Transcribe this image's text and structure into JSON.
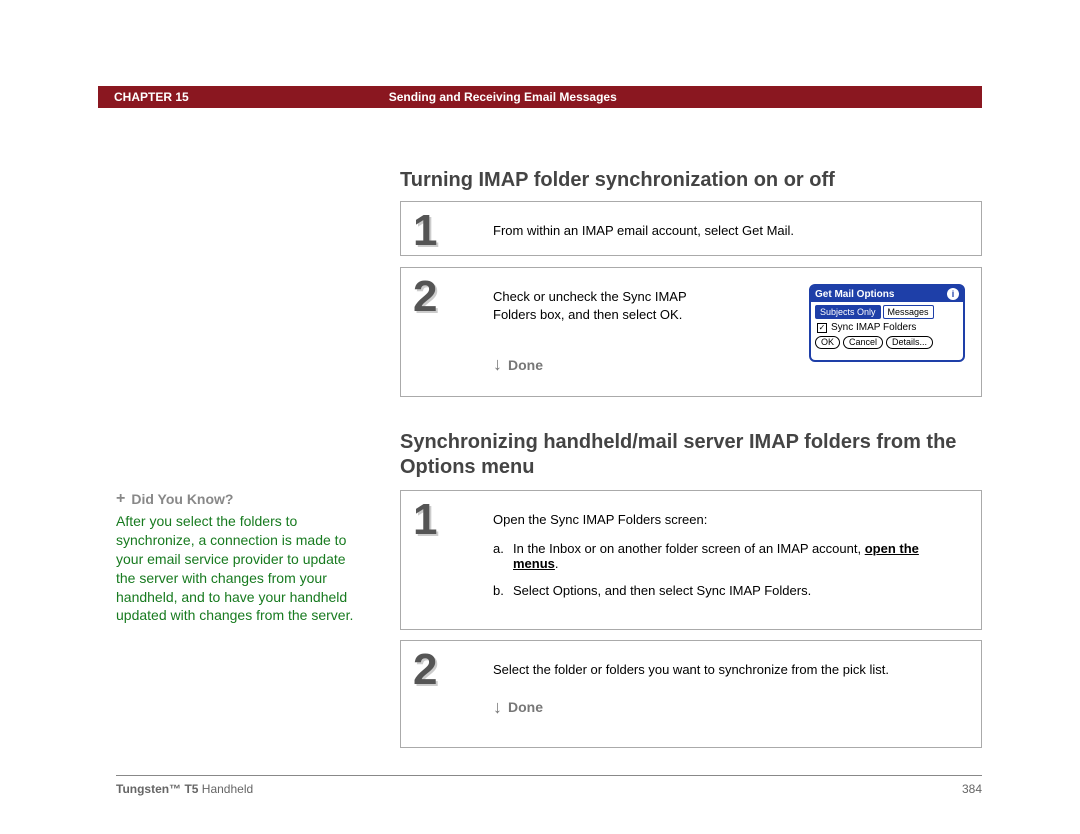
{
  "header": {
    "chapter": "CHAPTER 15",
    "title": "Sending and Receiving Email Messages"
  },
  "section1": {
    "title": "Turning IMAP folder synchronization on or off",
    "step1": {
      "num": "1",
      "text": "From within an IMAP email account, select Get Mail."
    },
    "step2": {
      "num": "2",
      "text": "Check or uncheck the Sync IMAP Folders box, and then select OK.",
      "done": "Done"
    }
  },
  "dialog": {
    "title": "Get Mail Options",
    "tab1": "Subjects Only",
    "tab2": "Messages",
    "check": "Sync IMAP Folders",
    "btn_ok": "OK",
    "btn_cancel": "Cancel",
    "btn_details": "Details..."
  },
  "section2": {
    "title": "Synchronizing handheld/mail server IMAP folders from the Options menu",
    "step1": {
      "num": "1",
      "text": "Open the Sync IMAP Folders screen:",
      "a_prefix": "In the Inbox or on another folder screen of an IMAP account, ",
      "a_link1": "open the",
      "a_link2": "menus",
      "a_period": ".",
      "b": "Select Options, and then select Sync IMAP Folders."
    },
    "step2": {
      "num": "2",
      "text": "Select the folder or folders you want to synchronize from the pick list.",
      "done": "Done"
    }
  },
  "sidebar": {
    "head": "Did You Know?",
    "body": "After you select the folders to synchronize, a connection is made to your email service provider to update the server with changes from your handheld, and to have your handheld updated with changes from the server."
  },
  "footer": {
    "product_bold": "Tungsten™ T5",
    "product_rest": " Handheld",
    "page": "384"
  }
}
